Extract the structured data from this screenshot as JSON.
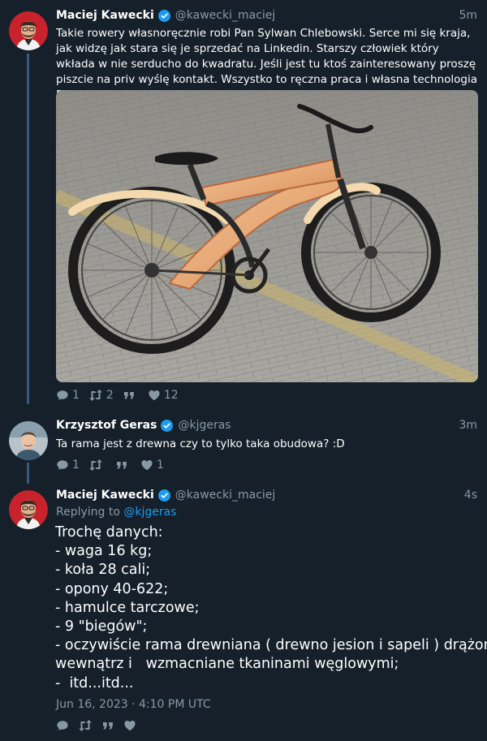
{
  "tweets": [
    {
      "author": "Maciej Kawecki",
      "handle": "@kawecki_maciej",
      "time": "5m",
      "text": "Takie rowery własnoręcznie robi Pan Sylwan Chlebowski. Serce mi się kraja, jak widzę jak stara się je sprzedać na Linkedin. Starszy człowiek który wkłada w nie serducho do kwadratu. Jeśli jest tu ktoś zainteresowany proszę piszcie na priv wyślę kontakt. Wszystko to ręczna praca i własna technologia Pana Sylwana.",
      "stats": {
        "replies": "1",
        "retweets": "2",
        "quotes": "",
        "likes": "12"
      }
    },
    {
      "author": "Krzysztof Geras",
      "handle": "@kjgeras",
      "time": "3m",
      "text": "Ta rama jest z drewna czy to tylko taka obudowa? :D",
      "stats": {
        "replies": "1",
        "retweets": "",
        "quotes": "",
        "likes": "1"
      }
    },
    {
      "author": "Maciej Kawecki",
      "handle": "@kawecki_maciej",
      "time": "4s",
      "replying_prefix": "Replying to",
      "replying_to": "@kjgeras",
      "lines": [
        "Trochę danych:",
        "- waga 16 kg;",
        "- koła 28 cali;",
        "- opony 40-622;",
        "- hamulce tarczowe;",
        "- 9 \"biegów\";",
        "- oczywiście rama drewniana ( drewno jesion i sapeli ) drążona",
        "wewnątrz i   wzmacniane tkaninami węglowymi;",
        "-  itd...itd..."
      ],
      "date": "Jun 16, 2023 · 4:10 PM UTC"
    }
  ],
  "icons": {
    "reply": "comment-icon",
    "retweet": "retweet-icon",
    "quote": "quote-icon",
    "like": "heart-icon",
    "verified": "verified-badge-icon"
  },
  "colors": {
    "background": "#15202b",
    "text": "#ffffff",
    "muted": "#8899a6",
    "link": "#1d9bf0",
    "thread_line": "#3a5a7a"
  }
}
